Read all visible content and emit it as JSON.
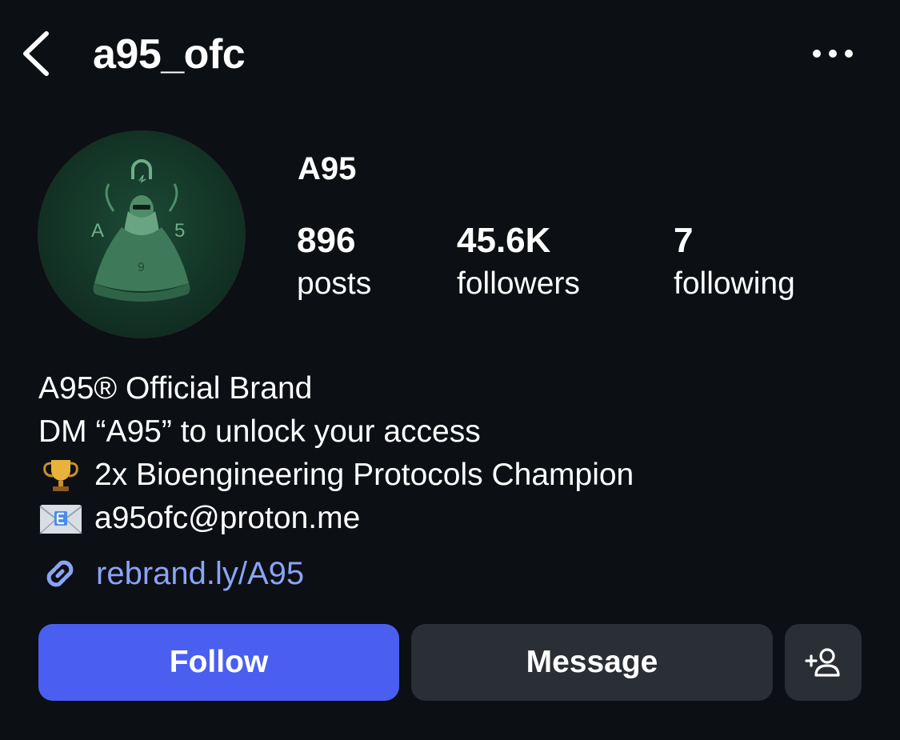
{
  "header": {
    "username": "a95_ofc",
    "back_icon": "chevron-left-icon",
    "more_icon": "more-horizontal-icon"
  },
  "profile": {
    "display_name": "A95",
    "avatar_letters": [
      "A",
      "5",
      "9"
    ],
    "stats": [
      {
        "value": "896",
        "label": "posts"
      },
      {
        "value": "45.6K",
        "label": "followers"
      },
      {
        "value": "7",
        "label": "following"
      }
    ]
  },
  "bio": {
    "line1": "A95® Official Brand",
    "line2": "DM “A95” to unlock your access",
    "line3": "2x Bioengineering Protocols Champion",
    "line3_icon": "trophy-icon",
    "line4": "a95ofc@proton.me",
    "line4_icon": "envelope-icon"
  },
  "link": {
    "text": "rebrand.ly/A95",
    "icon": "link-icon",
    "color": "#8aa4f5"
  },
  "actions": {
    "follow_label": "Follow",
    "message_label": "Message",
    "add_user_icon": "add-user-icon",
    "follow_color": "#4a5ff0",
    "secondary_color": "#2a2e35"
  }
}
